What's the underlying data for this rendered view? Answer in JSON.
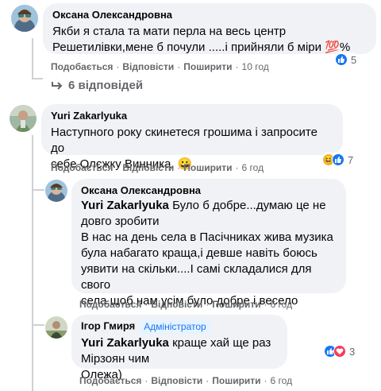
{
  "comments": [
    {
      "author": "Оксана Олександровна",
      "text_lines": [
        "Якби я стала та мати перла на весь центр",
        "Решетилівки,мене б почули .....і прийняли б міри 💯%"
      ],
      "like": "Подобається",
      "reply": "Відповісти",
      "share": "Поширити",
      "time": "10 год",
      "reaction_count": "5",
      "replies_label": "6 відповідей"
    },
    {
      "author": "Yuri Zakarlyuka",
      "text_lines": [
        "Наступного року скинетеся грошима і запросите до",
        "себе Олєжку Винника. 😀"
      ],
      "like": "Подобається",
      "reply": "Відповісти",
      "share": "Поширити",
      "time": "6 год",
      "reaction_count": "7"
    }
  ],
  "replies": [
    {
      "author": "Оксана Олександровна",
      "mention": "Yuri Zakarlyuka",
      "text_first": " Було б добре...думаю це не",
      "text_lines": [
        "довго зробити",
        "В нас на день села в Пасічниках жива музика",
        "була набагато краща,і девше навіть боюсь",
        "уявити на скільки....І самі складалися для свого",
        "села,щоб нам усім було добре і весело"
      ],
      "like": "Подобається",
      "reply": "Відповісти",
      "share": "Поширити",
      "time": "6 год"
    },
    {
      "author": "Ігор Гмиря",
      "badge": "Адміністратор",
      "mention": "Yuri Zakarlyuka",
      "text_first": " краще хай ще раз Мірзоян чим",
      "text_lines": [
        "Олежа)"
      ],
      "like": "Подобається",
      "reply": "Відповісти",
      "share": "Поширити",
      "time": "6 год",
      "reaction_count": "3"
    }
  ],
  "colors": {
    "bubble": "#f0f2f5",
    "meta": "#65676b",
    "like_blue": "#1877f2",
    "heart_red": "#f33e58",
    "haha_yellow": "#f7b125"
  }
}
